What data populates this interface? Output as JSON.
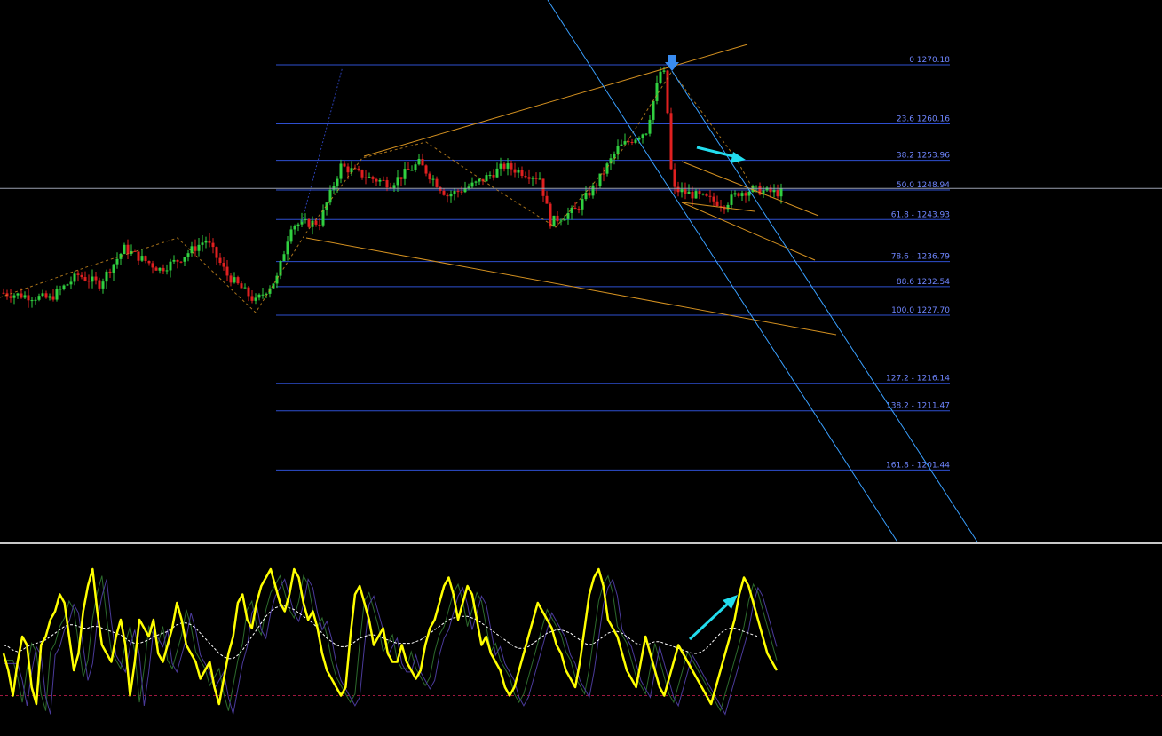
{
  "chart_data": [
    {
      "type": "candlestick",
      "fib_levels": [
        {
          "label": "0 1270.18",
          "price": 1270.18
        },
        {
          "label": "23.6 1260.16",
          "price": 1260.16
        },
        {
          "label": "38.2 1253.96",
          "price": 1253.96
        },
        {
          "label": "50.0 1248.94",
          "price": 1248.94
        },
        {
          "label": "61.8 - 1243.93",
          "price": 1243.93
        },
        {
          "label": "78.6 - 1236.79",
          "price": 1236.79
        },
        {
          "label": "88.6 1232.54",
          "price": 1232.54
        },
        {
          "label": "100.0 1227.70",
          "price": 1227.7
        },
        {
          "label": "127.2 - 1216.14",
          "price": 1216.14
        },
        {
          "label": "138.2 - 1211.47",
          "price": 1211.47
        },
        {
          "label": "161.8 - 1201.44",
          "price": 1201.44
        }
      ],
      "current_price": 1249.2,
      "bar_count": 220,
      "waypoints": [
        [
          0,
          1231.5
        ],
        [
          14,
          1230.5
        ],
        [
          22,
          1234.5
        ],
        [
          28,
          1233.0
        ],
        [
          35,
          1239.0
        ],
        [
          45,
          1235.5
        ],
        [
          50,
          1237.0
        ],
        [
          58,
          1240.5
        ],
        [
          64,
          1234.5
        ],
        [
          72,
          1230.0
        ],
        [
          78,
          1234.0
        ],
        [
          82,
          1243.0
        ],
        [
          90,
          1243.5
        ],
        [
          96,
          1253.0
        ],
        [
          104,
          1251.0
        ],
        [
          110,
          1250.0
        ],
        [
          118,
          1253.5
        ],
        [
          126,
          1248.0
        ],
        [
          134,
          1250.0
        ],
        [
          142,
          1253.0
        ],
        [
          152,
          1251.0
        ],
        [
          155,
          1243.5
        ],
        [
          162,
          1245.5
        ],
        [
          168,
          1250.0
        ],
        [
          174,
          1256.0
        ],
        [
          182,
          1259.0
        ],
        [
          186,
          1269.0
        ],
        [
          188,
          1259.0
        ],
        [
          190,
          1249.0
        ],
        [
          196,
          1248.0
        ],
        [
          204,
          1246.5
        ],
        [
          208,
          1248.5
        ],
        [
          212,
          1249.0
        ],
        [
          218,
          1248.5
        ]
      ],
      "bull_color": "#30d040",
      "bear_color": "#e02020",
      "fib_color": "#2e4fd0",
      "trendline_color": "#d39020",
      "channel_color": "#3aa0ff",
      "arrow_color": "#22ddee",
      "marker_color": "#3a8cf0"
    },
    {
      "type": "line",
      "ylim": [
        0,
        100
      ],
      "series": [
        {
          "color": "#ffff00",
          "values": [
            40,
            30,
            15,
            35,
            50,
            45,
            20,
            10,
            45,
            50,
            60,
            65,
            75,
            70,
            50,
            30,
            40,
            65,
            80,
            90,
            65,
            45,
            40,
            35,
            50,
            60,
            45,
            15,
            35,
            60,
            55,
            50,
            60,
            40,
            35,
            45,
            55,
            70,
            60,
            45,
            40,
            35,
            25,
            30,
            35,
            20,
            10,
            25,
            40,
            50,
            70,
            75,
            60,
            55,
            70,
            80,
            85,
            90,
            80,
            70,
            65,
            75,
            90,
            85,
            70,
            60,
            65,
            55,
            40,
            30,
            25,
            20,
            15,
            20,
            50,
            75,
            80,
            70,
            60,
            45,
            50,
            55,
            40,
            35,
            35,
            45,
            35,
            30,
            25,
            30,
            45,
            55,
            60,
            70,
            80,
            85,
            75,
            60,
            70,
            80,
            75,
            60,
            45,
            50,
            40,
            35,
            30,
            20,
            15,
            20,
            30,
            40,
            50,
            60,
            70,
            65,
            60,
            55,
            45,
            40,
            30,
            25,
            20,
            35,
            55,
            75,
            85,
            90,
            80,
            60,
            55,
            50,
            40,
            30,
            25,
            20,
            35,
            50,
            40,
            30,
            20,
            15,
            25,
            35,
            45,
            40,
            35,
            30,
            25,
            20,
            15,
            10,
            20,
            30,
            40,
            50,
            60,
            75,
            85,
            80,
            70,
            60,
            50,
            40,
            35,
            30
          ]
        },
        {
          "color": "#ffffff",
          "values": [
            45,
            44,
            42,
            41,
            42,
            44,
            45,
            46,
            47,
            48,
            50,
            52,
            54,
            56,
            57,
            57,
            56,
            55,
            55,
            56,
            56,
            55,
            54,
            53,
            52,
            51,
            49,
            47,
            46,
            46,
            47,
            48,
            50,
            51,
            52,
            53,
            55,
            57,
            58,
            58,
            57,
            55,
            52,
            49,
            46,
            43,
            40,
            38,
            37,
            37,
            39,
            42,
            46,
            50,
            54,
            58,
            62,
            65,
            67,
            68,
            68,
            67,
            66,
            64,
            62,
            60,
            58,
            55,
            52,
            49,
            47,
            45,
            44,
            44,
            45,
            47,
            49,
            50,
            51,
            51,
            50,
            49,
            48,
            47,
            46,
            46,
            46,
            46,
            47,
            48,
            50,
            52,
            54,
            56,
            58,
            60,
            61,
            62,
            62,
            62,
            61,
            60,
            58,
            56,
            54,
            52,
            50,
            48,
            46,
            44,
            43,
            43,
            44,
            46,
            48,
            50,
            52,
            53,
            54,
            54,
            53,
            52,
            50,
            48,
            46,
            45,
            46,
            48,
            50,
            52,
            53,
            53,
            52,
            50,
            48,
            46,
            45,
            45,
            46,
            47,
            47,
            46,
            45,
            44,
            43,
            42,
            41,
            40,
            40,
            41,
            43,
            46,
            49,
            52,
            54,
            55,
            55,
            54,
            53,
            52,
            51,
            50
          ]
        }
      ],
      "reference_line": 15,
      "ref_color": "#a01840"
    }
  ]
}
